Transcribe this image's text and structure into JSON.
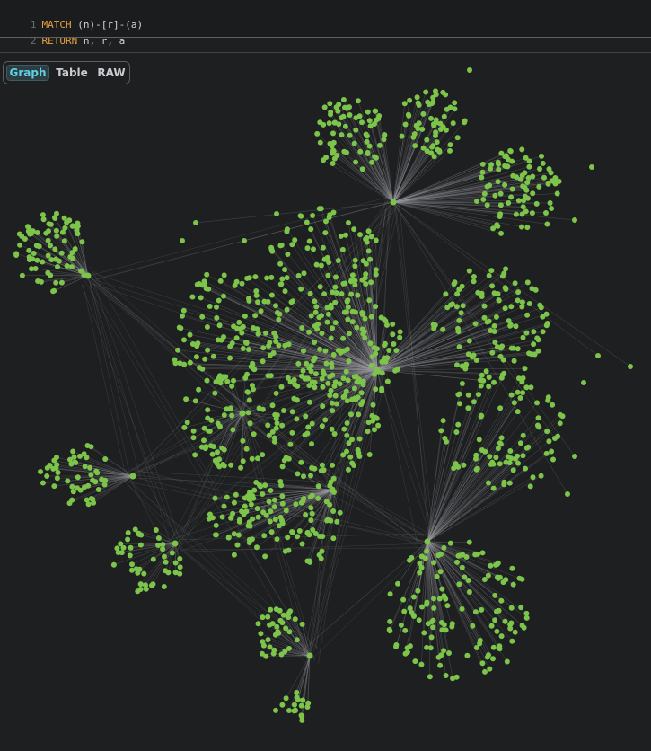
{
  "editor": {
    "lines": [
      {
        "num": "1",
        "keyword": "MATCH",
        "rest": " (n)-[r]-(a)"
      },
      {
        "num": "2",
        "keyword": "RETURN",
        "rest": " n, r, a"
      }
    ]
  },
  "view_tabs": [
    {
      "label": "Graph",
      "active": true
    },
    {
      "label": "Table",
      "active": false
    },
    {
      "label": "RAW",
      "active": false
    }
  ],
  "colors": {
    "node": "#7cc44a",
    "edge": "#9a9ca0",
    "keyword": "#e6a33e",
    "active_tab": "#5fd2e3"
  },
  "graph": {
    "description": "force-directed node graph with several hundred green nodes and hub nodes connected by thin grey edges"
  }
}
